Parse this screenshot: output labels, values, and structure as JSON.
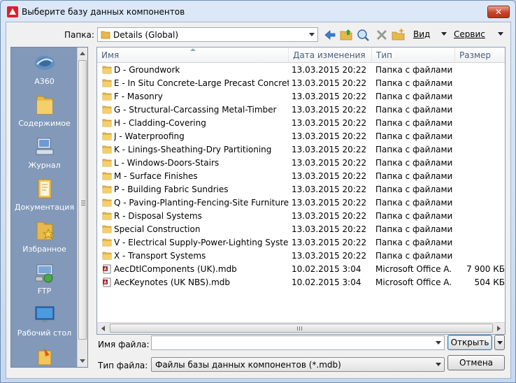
{
  "window": {
    "title": "Выберите базу данных компонентов",
    "close_label": "✕"
  },
  "toolbar": {
    "folder_label": "Папка:",
    "folder_value": "Details (Global)",
    "view_label": "Вид",
    "tools_label": "Сервис"
  },
  "places": [
    {
      "label": "A360",
      "icon": "a360-icon"
    },
    {
      "label": "Содержимое",
      "icon": "folder-icon"
    },
    {
      "label": "Журнал",
      "icon": "history-icon"
    },
    {
      "label": "Документация",
      "icon": "documents-icon"
    },
    {
      "label": "Избранное",
      "icon": "favorites-icon"
    },
    {
      "label": "FTP",
      "icon": "ftp-icon"
    },
    {
      "label": "Рабочий стол",
      "icon": "desktop-icon"
    },
    {
      "label": "",
      "icon": "buzzsaw-icon"
    }
  ],
  "columns": {
    "name": "Имя",
    "date": "Дата изменения",
    "type": "Тип",
    "size": "Размер"
  },
  "files": [
    {
      "name": "D - Groundwork",
      "date": "13.03.2015 20:22",
      "type": "Папка с файлами",
      "size": "",
      "kind": "folder"
    },
    {
      "name": "E - In Situ Concrete-Large Precast Concrete",
      "date": "13.03.2015 20:22",
      "type": "Папка с файлами",
      "size": "",
      "kind": "folder"
    },
    {
      "name": "F - Masonry",
      "date": "13.03.2015 20:22",
      "type": "Папка с файлами",
      "size": "",
      "kind": "folder"
    },
    {
      "name": "G - Structural-Carcassing Metal-Timber",
      "date": "13.03.2015 20:22",
      "type": "Папка с файлами",
      "size": "",
      "kind": "folder"
    },
    {
      "name": "H - Cladding-Covering",
      "date": "13.03.2015 20:22",
      "type": "Папка с файлами",
      "size": "",
      "kind": "folder"
    },
    {
      "name": "J - Waterproofing",
      "date": "13.03.2015 20:22",
      "type": "Папка с файлами",
      "size": "",
      "kind": "folder"
    },
    {
      "name": "K - Linings-Sheathing-Dry Partitioning",
      "date": "13.03.2015 20:22",
      "type": "Папка с файлами",
      "size": "",
      "kind": "folder"
    },
    {
      "name": "L - Windows-Doors-Stairs",
      "date": "13.03.2015 20:22",
      "type": "Папка с файлами",
      "size": "",
      "kind": "folder"
    },
    {
      "name": "M - Surface Finishes",
      "date": "13.03.2015 20:22",
      "type": "Папка с файлами",
      "size": "",
      "kind": "folder"
    },
    {
      "name": "P - Building Fabric Sundries",
      "date": "13.03.2015 20:22",
      "type": "Папка с файлами",
      "size": "",
      "kind": "folder"
    },
    {
      "name": "Q - Paving-Planting-Fencing-Site Furniture",
      "date": "13.03.2015 20:22",
      "type": "Папка с файлами",
      "size": "",
      "kind": "folder"
    },
    {
      "name": "R - Disposal Systems",
      "date": "13.03.2015 20:22",
      "type": "Папка с файлами",
      "size": "",
      "kind": "folder"
    },
    {
      "name": "Special Construction",
      "date": "13.03.2015 20:22",
      "type": "Папка с файлами",
      "size": "",
      "kind": "folder"
    },
    {
      "name": "V - Electrical Supply-Power-Lighting Systems",
      "date": "13.03.2015 20:22",
      "type": "Папка с файлами",
      "size": "",
      "kind": "folder"
    },
    {
      "name": "X - Transport Systems",
      "date": "13.03.2015 20:22",
      "type": "Папка с файлами",
      "size": "",
      "kind": "folder"
    },
    {
      "name": "AecDtlComponents (UK).mdb",
      "date": "10.02.2015 3:04",
      "type": "Microsoft Office A...",
      "size": "7 900 КБ",
      "kind": "mdb"
    },
    {
      "name": "AecKeynotes (UK NBS).mdb",
      "date": "10.02.2015 3:04",
      "type": "Microsoft Office A...",
      "size": "504 КБ",
      "kind": "mdb"
    }
  ],
  "bottom": {
    "filename_label": "Имя файла:",
    "filename_value": "",
    "filetype_label": "Тип файла:",
    "filetype_value": "Файлы базы данных компонентов (*.mdb)",
    "open_label": "Открыть",
    "cancel_label": "Отмена"
  },
  "colors": {
    "places_bg": "#8299b9",
    "folder": "#e8b84a",
    "autodesk_red": "#d8232a"
  }
}
